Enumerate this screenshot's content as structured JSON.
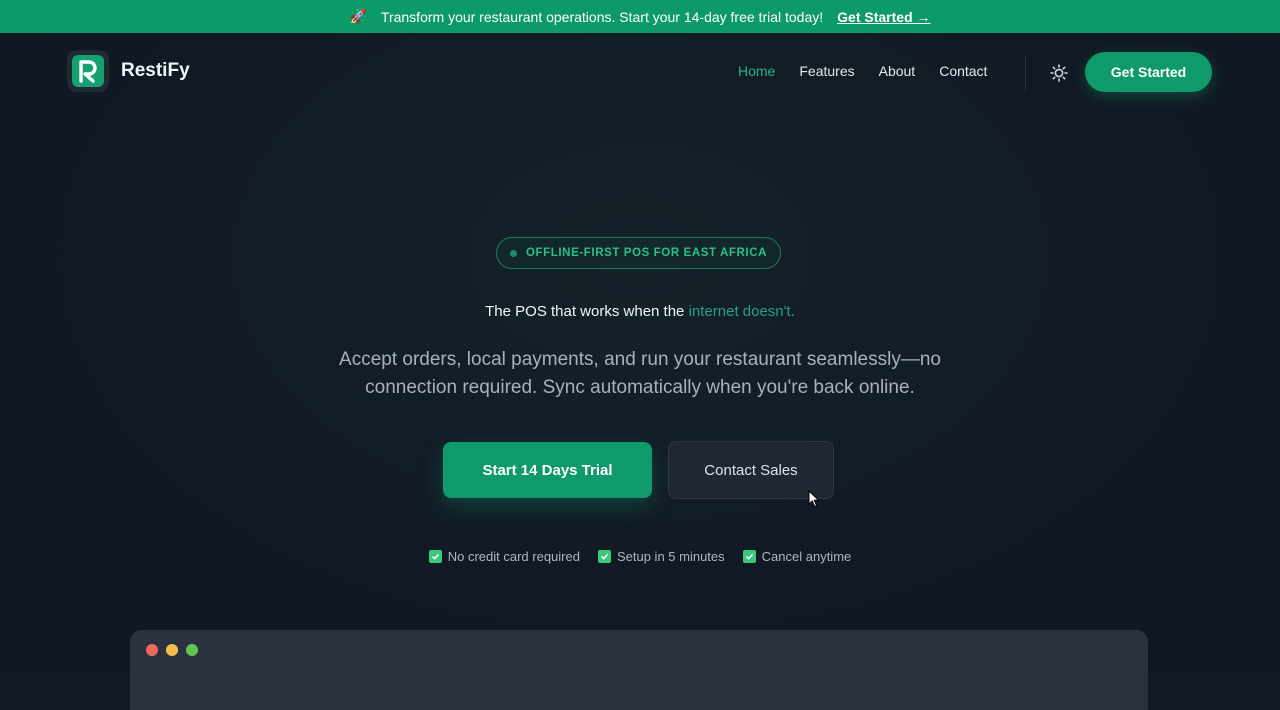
{
  "announcement": {
    "emoji": "🚀",
    "text": "Transform your restaurant operations.  Start your 14-day free trial today!",
    "link": "Get Started →"
  },
  "nav": {
    "brand": "RestiFy",
    "logo_letter": "R",
    "links": [
      "Home",
      "Features",
      "About",
      "Contact"
    ],
    "active_link": "Home",
    "theme_toggle_icon": "sun-icon",
    "cta": "Get Started"
  },
  "hero": {
    "badge": "OFFLINE-FIRST POS FOR EAST AFRICA",
    "headline_main": "The POS that works when the ",
    "headline_accent": "internet doesn't.",
    "subtitle": "Accept orders, local payments, and run your restaurant seamlessly—no connection required. Sync automatically when you're back online.",
    "primary_button": "Start 14 Days Trial",
    "secondary_button": "Contact Sales",
    "checks": [
      "No credit card required",
      "Setup in 5 minutes",
      "Cancel anytime"
    ]
  },
  "colors": {
    "brand_green": "#0e9a6b",
    "accent_text": "#2a9e86",
    "background": "#121a24",
    "window_dot_red": "#ec6a5e",
    "window_dot_yellow": "#f4bf4f",
    "window_dot_green": "#61c554"
  }
}
